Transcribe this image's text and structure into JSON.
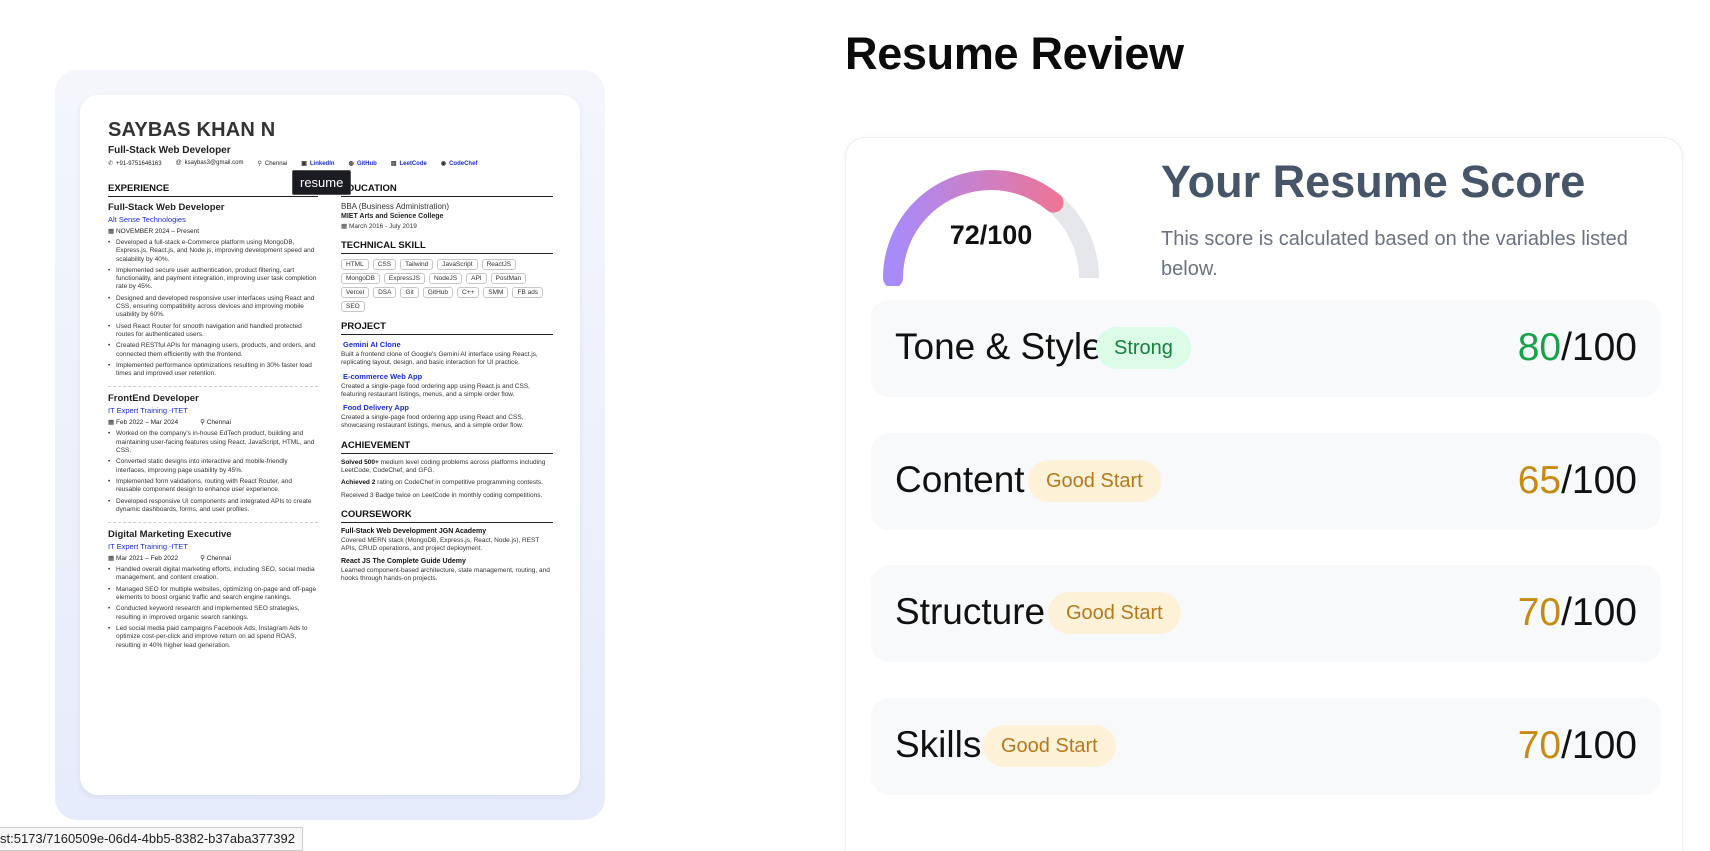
{
  "resume": {
    "name": "SAYBAS KHAN N",
    "role": "Full-Stack Web Developer",
    "contacts": {
      "phone": "+91-9751646163",
      "email": "ksaybas3@gmail.com",
      "location": "Chennai",
      "linkedin": "LinkedIn",
      "github": "GitHub",
      "leetcode": "LeetCode",
      "codechef": "CodeChef"
    },
    "tooltip": "resume",
    "experience": {
      "heading": "EXPERIENCE",
      "jobs": [
        {
          "title": "Full-Stack Web Developer",
          "company": "Alt Sense Technologies",
          "date": "NOVEMBER 2024 – Present",
          "location": "",
          "bullets": [
            "Developed a full-stack e-Commerce platform using MongoDB, Express.js, React.js, and Node.js, improving development speed and scalability by 40%.",
            "Implemented secure user authentication, product filtering, cart functionality, and payment integration, improving user task completion rate by 45%.",
            "Designed and developed responsive user interfaces using React and CSS, ensuring compatibility across devices and improving mobile usability by 60%.",
            "Used React Router for smooth navigation and handled protected routes for authenticated users.",
            "Created RESTful APIs for managing users, products, and orders, and connected them efficiently with the frontend.",
            "Implemented performance optimizations resulting in 30% faster load times and improved user retention."
          ]
        },
        {
          "title": "FrontEnd Developer",
          "company": "IT Expert Training -ITET",
          "date": "Feb 2022 – Mar 2024",
          "location": "Chennai",
          "bullets": [
            "Worked on the company's in-house EdTech product, building and maintaining user-facing features using React, JavaScript, HTML, and CSS.",
            "Converted static designs into interactive and mobile-friendly interfaces, improving page usability by 45%.",
            "Implemented form validations, routing with React Router, and reusable component design to enhance user experience.",
            "Developed responsive UI components and integrated APIs to create dynamic dashboards, forms, and user profiles."
          ]
        },
        {
          "title": "Digital Marketing Executive",
          "company": "IT Expert Training -ITET",
          "date": "Mar 2021 – Feb 2022",
          "location": "Chennai",
          "bullets": [
            "Handled overall digital marketing efforts, including SEO, social media management, and content creation.",
            "Managed SEO for multiple websites, optimizing on-page and off-page elements to boost organic traffic and search engine rankings.",
            "Conducted keyword research and implemented SEO strategies, resulting in improved organic search rankings.",
            "Led social media paid campaigns Facebook Ads, Instagram Ads to optimize cost-per-click and improve return on ad spend ROAS, resulting in 40% higher lead generation."
          ]
        }
      ]
    },
    "education": {
      "heading": "EDUCATION",
      "degree": "BBA (Business Administration)",
      "school": "MIET Arts and Science College",
      "date": "March 2016 - July 2019"
    },
    "skills": {
      "heading": "TECHNICAL SKILL",
      "items": [
        "HTML",
        "CSS",
        "Tailwind",
        "JavaScript",
        "ReactJS",
        "MongoDB",
        "ExpressJS",
        "NodeJS",
        "API",
        "PostMan",
        "Vercel",
        "DSA",
        "Git",
        "GitHub",
        "C++",
        "SMM",
        "FB ads",
        "SEO"
      ]
    },
    "projects": {
      "heading": "PROJECT",
      "items": [
        {
          "title": "Gemini AI Clone",
          "desc": "Built a frontend clone of Google's Gemini AI interface using React.js, replicating layout, design, and basic interaction for UI practice."
        },
        {
          "title": "E-commerce Web App",
          "desc": "Created a single-page food ordering app using React.js and CSS, featuring restaurant listings, menus, and a simple order flow."
        },
        {
          "title": "Food Delivery App",
          "desc": "Created a single-page food ordering app using React and CSS, showcasing restaurant listings, menus, and a simple order flow."
        }
      ]
    },
    "achievement": {
      "heading": "ACHIEVEMENT",
      "items": [
        {
          "bold": "Solved 500+",
          "text": " medium level coding problems across platforms including LeetCode, CodeChef, and GFG."
        },
        {
          "bold": "Achieved 2",
          "text": " rating on CodeChef in competitive programming contests."
        },
        {
          "bold": "",
          "text": "Received 3 Badge twice on LeetCode in monthly coding competitions."
        }
      ]
    },
    "coursework": {
      "heading": "COURSEWORK",
      "items": [
        {
          "title": "Full-Stack Web Development JGN Academy",
          "desc": "Covered MERN stack (MongoDB, Express.js, React, Node.js), REST APIs, CRUD operations, and project deployment."
        },
        {
          "title": "React JS The Complete Guide Udemy",
          "desc": "Learned component-based architecture, state management, routing, and hooks through hands-on projects."
        }
      ]
    }
  },
  "status_url": "st:5173/7160509e-06d4-4bb5-8382-b37aba377392",
  "review": {
    "title": "Resume Review",
    "score": {
      "value": 72,
      "max": 100,
      "display": "72/100",
      "heading": "Your Resume Score",
      "description": "This score is calculated based on the variables listed below."
    },
    "categories": [
      {
        "name": "Tone & Style",
        "badge": "Strong",
        "score": "80",
        "max": "/100",
        "level": "strong"
      },
      {
        "name": "Content",
        "badge": "Good Start",
        "score": "65",
        "max": "/100",
        "level": "good"
      },
      {
        "name": "Structure",
        "badge": "Good Start",
        "score": "70",
        "max": "/100",
        "level": "good"
      },
      {
        "name": "Skills",
        "badge": "Good Start",
        "score": "70",
        "max": "/100",
        "level": "good"
      }
    ]
  },
  "colors": {
    "strong": "#16a34a",
    "good": "#c98a14",
    "gauge_start": "#a78bfa",
    "gauge_end": "#fb7185",
    "gauge_track": "#e5e7eb"
  }
}
